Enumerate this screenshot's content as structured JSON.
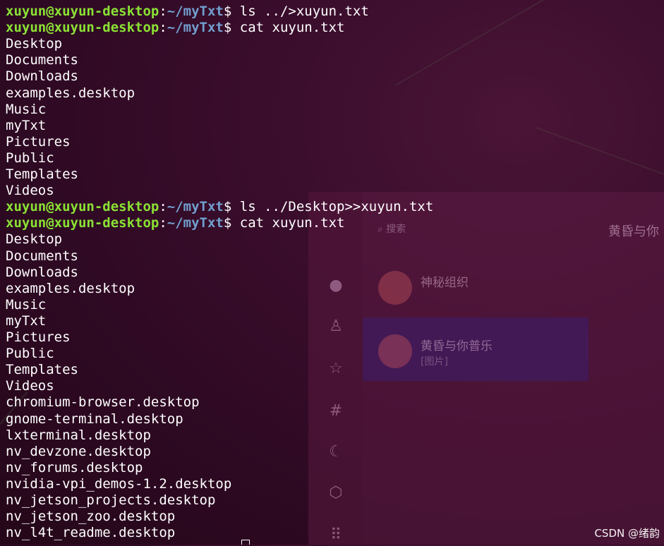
{
  "terminal": {
    "prompt_user": "xuyun@xuyun-desktop",
    "prompt_sep": ":",
    "prompt_path": "~/myTxt",
    "prompt_end": "$ ",
    "commands": [
      "ls ../>xuyun.txt",
      "cat xuyun.txt",
      "ls ../Desktop>>xuyun.txt",
      "cat xuyun.txt"
    ],
    "output_first": [
      "Desktop",
      "Documents",
      "Downloads",
      "examples.desktop",
      "Music",
      "myTxt",
      "Pictures",
      "Public",
      "Templates",
      "Videos"
    ],
    "output_second": [
      "Desktop",
      "Documents",
      "Downloads",
      "examples.desktop",
      "Music",
      "myTxt",
      "Pictures",
      "Public",
      "Templates",
      "Videos",
      "chromium-browser.desktop",
      "gnome-terminal.desktop",
      "lxterminal.desktop",
      "nv_devzone.desktop",
      "nv_forums.desktop",
      "nvidia-vpi_demos-1.2.desktop",
      "nv_jetson_projects.desktop",
      "nv_jetson_zoo.desktop",
      "nv_l4t_readme.desktop"
    ]
  },
  "background_app": {
    "search_placeholder": "搜索",
    "chat_title": "黄昏与你",
    "conversations": [
      {
        "name": "神秘组织",
        "message": "",
        "time": ""
      },
      {
        "name": "黄昏与你普乐",
        "message": "[图片]",
        "time": ""
      }
    ]
  },
  "watermark": "CSDN @绪韵",
  "colors": {
    "prompt_user": "#8ae234",
    "prompt_path": "#729fcf",
    "text": "#ffffff"
  }
}
